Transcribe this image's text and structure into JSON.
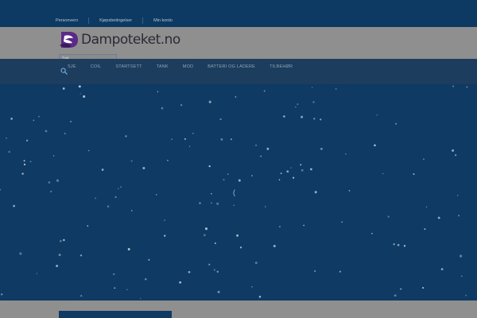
{
  "topbar": {
    "links": [
      "Personvern",
      "Kjøpsbetingelser",
      "Min konto"
    ]
  },
  "header": {
    "logo_text": "Dampoteket.no",
    "search": {
      "placeholder": "Søk"
    }
  },
  "nav": {
    "items": [
      "SJE",
      "COIL",
      "STARTSETT",
      "TANK",
      "MOD",
      "BATTERI OG LADERE",
      "TILBEHØR"
    ]
  },
  "colors": {
    "background": "#0e3a64",
    "header_bar": "#8f8f8f",
    "nav_bar": "#1d3d5e",
    "logo_purple": "#5b2a86",
    "dots": "#c8d3dc"
  },
  "icons": {
    "logo": "dampoteket-logo-icon",
    "search": "search-icon",
    "loading": "loading-spinner-icon"
  }
}
